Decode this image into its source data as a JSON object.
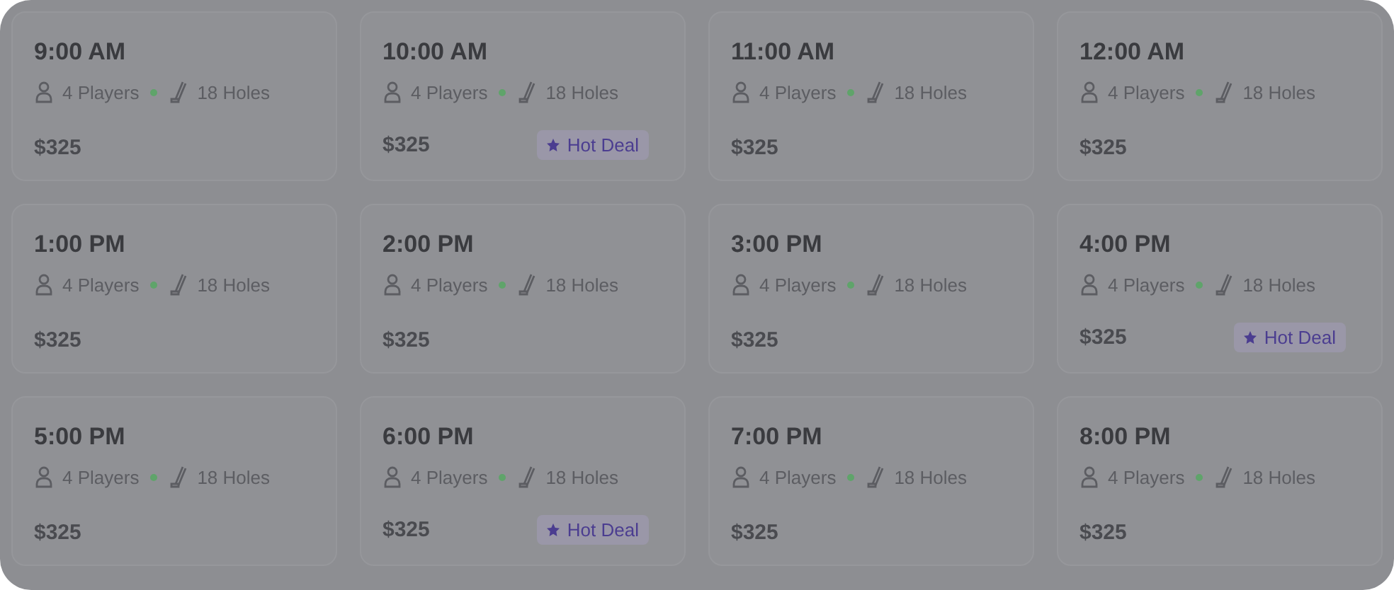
{
  "tee_times": [
    {
      "time": "9:00 AM",
      "players": "4 Players",
      "holes": "18 Holes",
      "price": "$325"
    },
    {
      "time": "10:00 AM",
      "players": "4 Players",
      "holes": "18 Holes",
      "price": "$325",
      "badge": "Hot Deal"
    },
    {
      "time": "11:00 AM",
      "players": "4 Players",
      "holes": "18 Holes",
      "price": "$325"
    },
    {
      "time": "12:00 AM",
      "players": "4 Players",
      "holes": "18 Holes",
      "price": "$325"
    },
    {
      "time": "1:00 PM",
      "players": "4 Players",
      "holes": "18 Holes",
      "price": "$325"
    },
    {
      "time": "2:00 PM",
      "players": "4 Players",
      "holes": "18 Holes",
      "price": "$325"
    },
    {
      "time": "3:00 PM",
      "players": "4 Players",
      "holes": "18 Holes",
      "price": "$325"
    },
    {
      "time": "4:00 PM",
      "players": "4 Players",
      "holes": "18 Holes",
      "price": "$325",
      "badge": "Hot Deal"
    },
    {
      "time": "5:00 PM",
      "players": "4 Players",
      "holes": "18 Holes",
      "price": "$325"
    },
    {
      "time": "6:00 PM",
      "players": "4 Players",
      "holes": "18 Holes",
      "price": "$325",
      "badge": "Hot Deal"
    },
    {
      "time": "7:00 PM",
      "players": "4 Players",
      "holes": "18 Holes",
      "price": "$325"
    },
    {
      "time": "8:00 PM",
      "players": "4 Players",
      "holes": "18 Holes",
      "price": "$325"
    }
  ]
}
